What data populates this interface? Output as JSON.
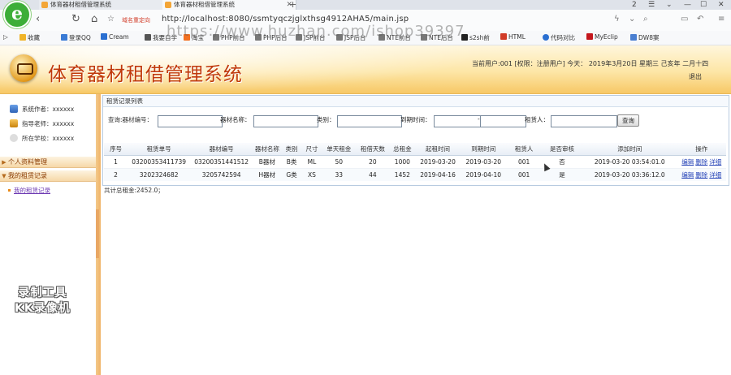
{
  "browser": {
    "tabs": [
      {
        "label": "体育器材租借管理系统"
      },
      {
        "label": "体育器材租借管理系统"
      }
    ],
    "new_tab": "+",
    "tab_counter": "2",
    "secure_label": "域名重定向",
    "url": "http://localhost:8080/ssmtyqczjglxthsg4912AHA5/main.jsp",
    "watermark": "https://www.huzhan.com/ishop39397",
    "bookmarks": [
      "收藏",
      "登录QQ",
      "Cream",
      "我要自学",
      "淘宝",
      "PHP前台",
      "PHP后台",
      "JSP前台",
      "JSP后台",
      "NTE前台",
      "NTE后台",
      "s2sh前",
      "HTML",
      "代码对比",
      "MyEclip",
      "DW8案"
    ]
  },
  "app": {
    "title": "体育器材租借管理系统",
    "userinfo": "当前用户:001 [权限：注册用户]  今天：  2019年3月20日 星期三  己亥年  二月十四",
    "logout": "退出"
  },
  "sidebar": {
    "info": [
      {
        "label": "系统作者：xxxxxx"
      },
      {
        "label": "指导老师：xxxxxx"
      },
      {
        "label": "所在学校：xxxxxx"
      }
    ],
    "menus": [
      {
        "label": "个人资料管理"
      },
      {
        "label": "我的租赁记录"
      }
    ],
    "sub_item": "我的租赁记录",
    "recorder": [
      "录制工具",
      "KK录像机"
    ]
  },
  "main": {
    "panel_title": "租赁记录列表",
    "search": {
      "query_label": "查询:",
      "fields": [
        "器材编号：",
        "器材名称：",
        "类别：",
        "到期时间：",
        "-",
        "租赁人："
      ],
      "button": "查询"
    },
    "table": {
      "headers": [
        "序号",
        "租赁单号",
        "器材编号",
        "器材名称",
        "类别",
        "尺寸",
        "单天租金",
        "租借天数",
        "总租金",
        "起租时间",
        "到期时间",
        "租赁人",
        "是否审核",
        "添加时间",
        "操作"
      ],
      "rows": [
        [
          "1",
          "03200353411739",
          "03200351441512",
          "B器材",
          "B类",
          "ML",
          "50",
          "20",
          "1000",
          "2019-03-20",
          "2019-03-20",
          "001",
          "否",
          "2019-03-20 03:54:01.0"
        ],
        [
          "2",
          "3202324682",
          "3205742594",
          "H器材",
          "G类",
          "XS",
          "33",
          "44",
          "1452",
          "2019-04-16",
          "2019-04-10",
          "001",
          "是",
          "2019-03-20 03:36:12.0"
        ]
      ],
      "actions": [
        "编辑",
        "删除",
        "详细"
      ]
    },
    "total": "共计总租金:2452.0；"
  }
}
